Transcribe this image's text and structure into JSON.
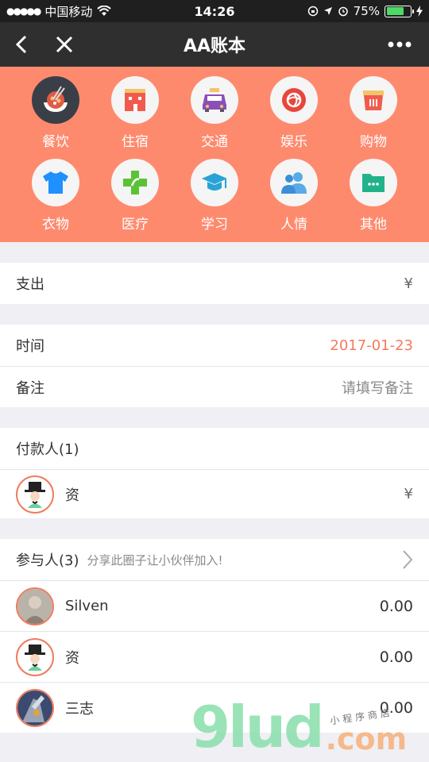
{
  "status_bar": {
    "carrier": "中国移动",
    "time": "14:26",
    "battery": "75%",
    "battery_level": 0.75
  },
  "nav": {
    "title": "AA账本"
  },
  "categories": [
    {
      "label": "餐饮",
      "icon": "food-bowl-icon",
      "selected": true
    },
    {
      "label": "住宿",
      "icon": "hotel-icon"
    },
    {
      "label": "交通",
      "icon": "taxi-icon"
    },
    {
      "label": "娱乐",
      "icon": "entertainment-icon"
    },
    {
      "label": "购物",
      "icon": "shopping-basket-icon"
    },
    {
      "label": "衣物",
      "icon": "tshirt-icon"
    },
    {
      "label": "医疗",
      "icon": "medical-cross-icon"
    },
    {
      "label": "学习",
      "icon": "graduation-cap-icon"
    },
    {
      "label": "人情",
      "icon": "people-icon"
    },
    {
      "label": "其他",
      "icon": "folder-icon"
    }
  ],
  "expense": {
    "label": "支出",
    "currency": "¥"
  },
  "time": {
    "label": "时间",
    "value": "2017-01-23"
  },
  "note": {
    "label": "备注",
    "placeholder": "请填写备注"
  },
  "payers": {
    "label": "付款人(1)",
    "items": [
      {
        "name": "资",
        "currency": "¥"
      }
    ]
  },
  "participants": {
    "label": "参与人(3)",
    "hint": "分享此圈子让小伙伴加入!",
    "items": [
      {
        "name": "Silven",
        "amount": "0.00"
      },
      {
        "name": "资",
        "amount": "0.00"
      },
      {
        "name": "三志",
        "amount": "0.00"
      }
    ]
  },
  "watermark": {
    "main": "9lud",
    "suffix": ".com",
    "tagline": "小程序商店"
  }
}
